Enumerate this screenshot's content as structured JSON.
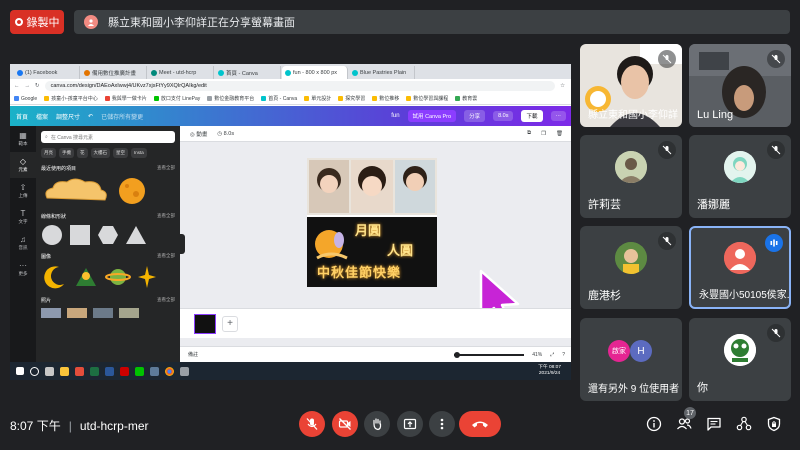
{
  "recording": {
    "label": "錄製中"
  },
  "presentation": {
    "banner": "縣立東和國小李仰詳正在分享螢幕畫面"
  },
  "browser": {
    "tabs": [
      {
        "label": "(1) Facebook",
        "color": "#1877f2"
      },
      {
        "label": "備用數位推廣計畫",
        "color": "#e37400"
      },
      {
        "label": "Meet - utd-hcrp",
        "color": "#00897b"
      },
      {
        "label": "首頁 - Canva",
        "color": "#00c4cc"
      },
      {
        "label": "fun - 800 x 800 px",
        "color": "#00c4cc"
      },
      {
        "label": "Blue Pastries Plain",
        "color": "#00c4cc"
      }
    ],
    "url": "canva.com/design/DAEoAxIwwj4/UKvz7xjsFtYy9XQIrQAIkg/edit",
    "bookmarks": [
      "Google",
      "孩童小-孩童平台中心",
      "我與學一做卡片",
      "放口支付 LinePay",
      "數位金融教育平台",
      "首頁 - Canva",
      "單元設計",
      "探究學習",
      "數位推移",
      "數位學習與課程",
      "教育雲"
    ]
  },
  "canva": {
    "home": "首頁",
    "file": "檔案",
    "resize": "調整尺寸",
    "autosave": "已儲存所有變更",
    "design_name": "fun",
    "try_pro": "試用 Canva Pro",
    "share": "分享",
    "play": "8.0s",
    "download": "下載",
    "rail": [
      "範本",
      "元素",
      "上傳",
      "文字",
      "音訊",
      "更多"
    ],
    "search_placeholder": "在 Canva 搜尋元素",
    "chips": [
      "月亮",
      "手機",
      "花",
      "大樓石",
      "星空",
      "Insta"
    ],
    "sections": [
      {
        "title": "最近使用的項目",
        "more": "查看全部"
      },
      {
        "title": "線條和形狀",
        "more": "查看全部"
      },
      {
        "title": "圖像",
        "more": "查看全部"
      },
      {
        "title": "照片",
        "more": "查看全部"
      }
    ],
    "animate": "動畫",
    "duration": "8.0s",
    "poster_title_1": "月圓",
    "poster_title_2": "人圓",
    "poster_title_3": "中秋佳節快樂",
    "notes": "備註",
    "zoom": "41%",
    "taskbar_time": "下午 08:07",
    "taskbar_date": "2021/9/24"
  },
  "participants": [
    {
      "name": "縣立東和國小李仰詳",
      "muted": true
    },
    {
      "name": "Lu Ling",
      "muted": true
    },
    {
      "name": "許莉芸",
      "muted": true
    },
    {
      "name": "潘娜麗",
      "muted": true
    },
    {
      "name": "鹿港杉",
      "muted": true
    },
    {
      "name": "永豐國小50105侯家...",
      "muted": false,
      "speaking": true
    },
    {
      "name": "還有另外 9 位使用者",
      "muted": false
    },
    {
      "name": "你",
      "muted": true
    }
  ],
  "others_avatars": [
    "啟家",
    "H"
  ],
  "meeting": {
    "time": "8:07 下午",
    "code": "utd-hcrp-mer",
    "participant_count": "17"
  },
  "colors": {
    "meet_bg": "#202124",
    "tile_bg": "#3c4043",
    "red": "#ea4335",
    "speaking_border": "#8ab4f8"
  }
}
